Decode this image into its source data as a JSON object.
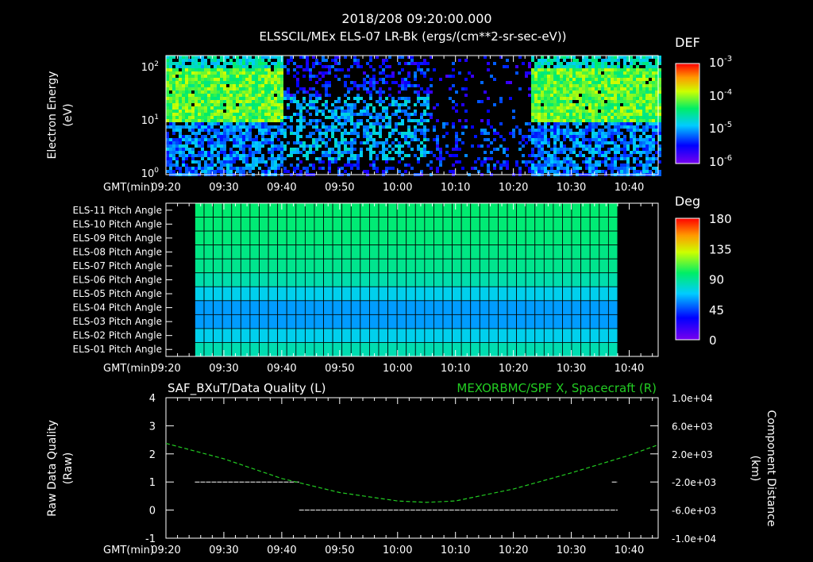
{
  "header": {
    "title": "2018/208 09:20:00.000",
    "subtitle": "ELSSCIL/MEx ELS-07 LR-Bk  (ergs/(cm**2-sr-sec-eV))"
  },
  "colors": {
    "background": "#000000",
    "axes": "#ffffff",
    "grid": "#000000",
    "component_line": "#22cc22"
  },
  "chart_data": [
    {
      "type": "heatmap",
      "title": "ELSSCIL/MEx ELS-07 LR-Bk  (ergs/(cm**2-sr-sec-eV))",
      "ylabel": "Electron Energy (eV)",
      "ylabel_lines": [
        "Electron Energy",
        "(eV)"
      ],
      "xlabel": "GMT(min)",
      "x_range_min": [
        0,
        85
      ],
      "x_tick_labels": [
        "09:20",
        "09:30",
        "09:40",
        "09:50",
        "10:00",
        "10:10",
        "10:20",
        "10:30",
        "10:40"
      ],
      "y_scale": "log",
      "y_range": [
        1,
        160
      ],
      "y_tick_labels": [
        "10^0",
        "10^1",
        "10^2"
      ],
      "colorbar": {
        "label": "DEF",
        "scale": "log",
        "range": [
          1e-06,
          0.001
        ],
        "tick_labels": [
          "10^-6",
          "10^-5",
          "10^-4",
          "10^-3"
        ]
      },
      "regions": [
        {
          "x": [
            0,
            20
          ],
          "y": [
            10,
            100
          ],
          "level": "high"
        },
        {
          "x": [
            20,
            45
          ],
          "y": [
            2,
            30
          ],
          "level": "medium"
        },
        {
          "x": [
            45,
            63
          ],
          "y": [
            1,
            10
          ],
          "level": "low"
        },
        {
          "x": [
            63,
            85
          ],
          "y": [
            10,
            100
          ],
          "level": "high"
        }
      ]
    },
    {
      "type": "heatmap",
      "xlabel": "GMT(min)",
      "x_tick_labels": [
        "09:20",
        "09:30",
        "09:40",
        "09:50",
        "10:00",
        "10:10",
        "10:20",
        "10:30",
        "10:40"
      ],
      "x_data_range_min": [
        5,
        78
      ],
      "rows": [
        "ELS-11 Pitch Angle",
        "ELS-10 Pitch Angle",
        "ELS-09 Pitch Angle",
        "ELS-08 Pitch Angle",
        "ELS-07 Pitch Angle",
        "ELS-06 Pitch Angle",
        "ELS-05 Pitch Angle",
        "ELS-04 Pitch Angle",
        "ELS-03 Pitch Angle",
        "ELS-02 Pitch Angle",
        "ELS-01 Pitch Angle"
      ],
      "values_deg": [
        97,
        96,
        95,
        93,
        91,
        85,
        72,
        60,
        60,
        72,
        84
      ],
      "colorbar": {
        "label": "Deg",
        "range": [
          0,
          180
        ],
        "tick_labels": [
          "180",
          "135",
          "90",
          "45",
          "0"
        ]
      }
    },
    {
      "type": "line",
      "title_left": "SAF_BXuT/Data Quality (L)",
      "title_right": "MEXORBMC/SPF X, Spacecraft (R)",
      "ylabel_left_lines": [
        "Raw Data Quality",
        "(Raw)"
      ],
      "ylabel_right_lines": [
        "Component Distance",
        "(km)"
      ],
      "xlabel": "GMT(min)",
      "x_tick_labels": [
        "09:20",
        "09:30",
        "09:40",
        "09:50",
        "10:00",
        "10:10",
        "10:20",
        "10:30",
        "10:40"
      ],
      "ylim_left": [
        -1,
        4
      ],
      "y_ticks_left": [
        "4",
        "3",
        "2",
        "1",
        "0",
        "-1"
      ],
      "ylim_right": [
        -10000,
        10000
      ],
      "y_ticks_right": [
        "1.0e+04",
        "6.0e+03",
        "2.0e+03",
        "-2.0e+03",
        "-6.0e+03",
        "-1.0e+04"
      ],
      "series": [
        {
          "axis": "left",
          "x_min": [
            5,
            23
          ],
          "y": [
            1,
            1
          ]
        },
        {
          "axis": "left",
          "x_min": [
            23,
            78
          ],
          "y": [
            0,
            0
          ]
        },
        {
          "axis": "left",
          "x_min": [
            77,
            78
          ],
          "y": [
            1,
            1
          ]
        },
        {
          "axis": "right",
          "x_min": [
            0,
            10,
            20,
            30,
            40,
            45,
            50,
            60,
            70,
            80,
            85
          ],
          "y": [
            3500,
            1300,
            -1500,
            -3500,
            -4700,
            -4900,
            -4700,
            -3000,
            -700,
            1800,
            3300
          ]
        }
      ]
    }
  ]
}
